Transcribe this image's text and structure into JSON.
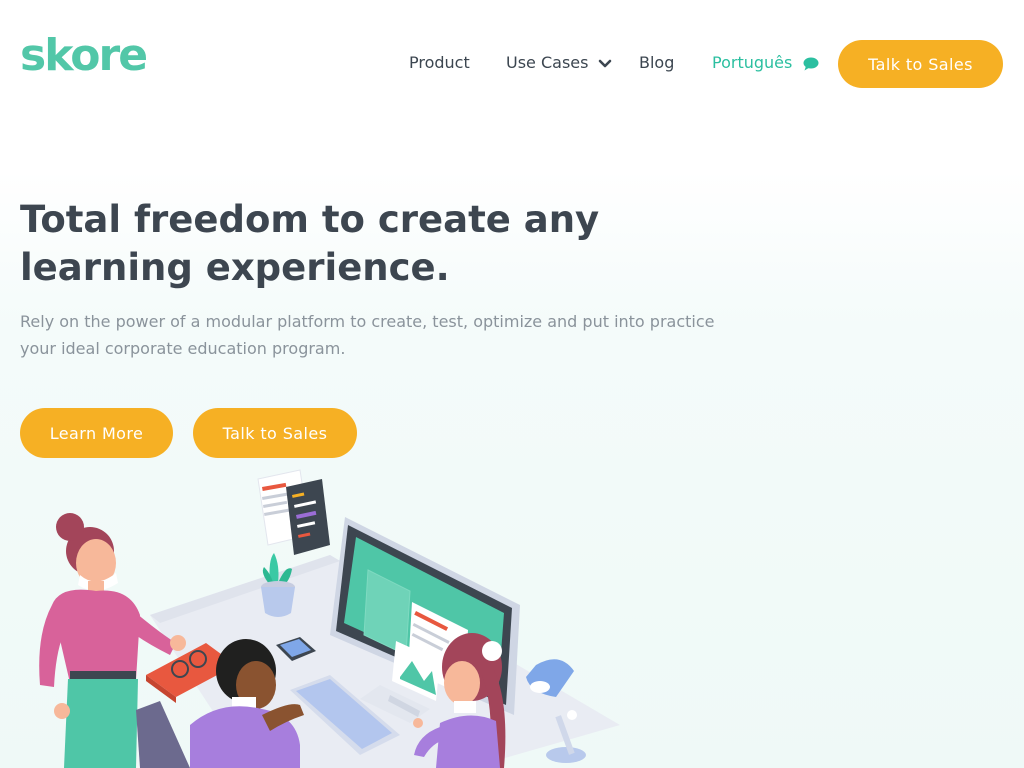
{
  "brand": {
    "logo_text": "skore",
    "color": "#52c7a8"
  },
  "nav": {
    "items": [
      {
        "label": "Product"
      },
      {
        "label": "Use Cases",
        "icon": "chevron-down-icon"
      },
      {
        "label": "Blog"
      },
      {
        "label": "Português",
        "icon": "chat-bubble-icon"
      }
    ],
    "cta_label": "Talk to Sales"
  },
  "hero": {
    "title": "Total freedom to create any learning experience.",
    "subtitle": "Rely on the power of a modular platform to create, test, optimize and put into practice your ideal corporate education program.",
    "primary_button": "Learn More",
    "secondary_button": "Talk to Sales"
  },
  "colors": {
    "accent": "#f6b024",
    "teal": "#2bbfa0",
    "text_dark": "#3d4650",
    "text_muted": "#8a939b"
  },
  "illustration": {
    "icon": "team-working-at-desk-illustration"
  }
}
